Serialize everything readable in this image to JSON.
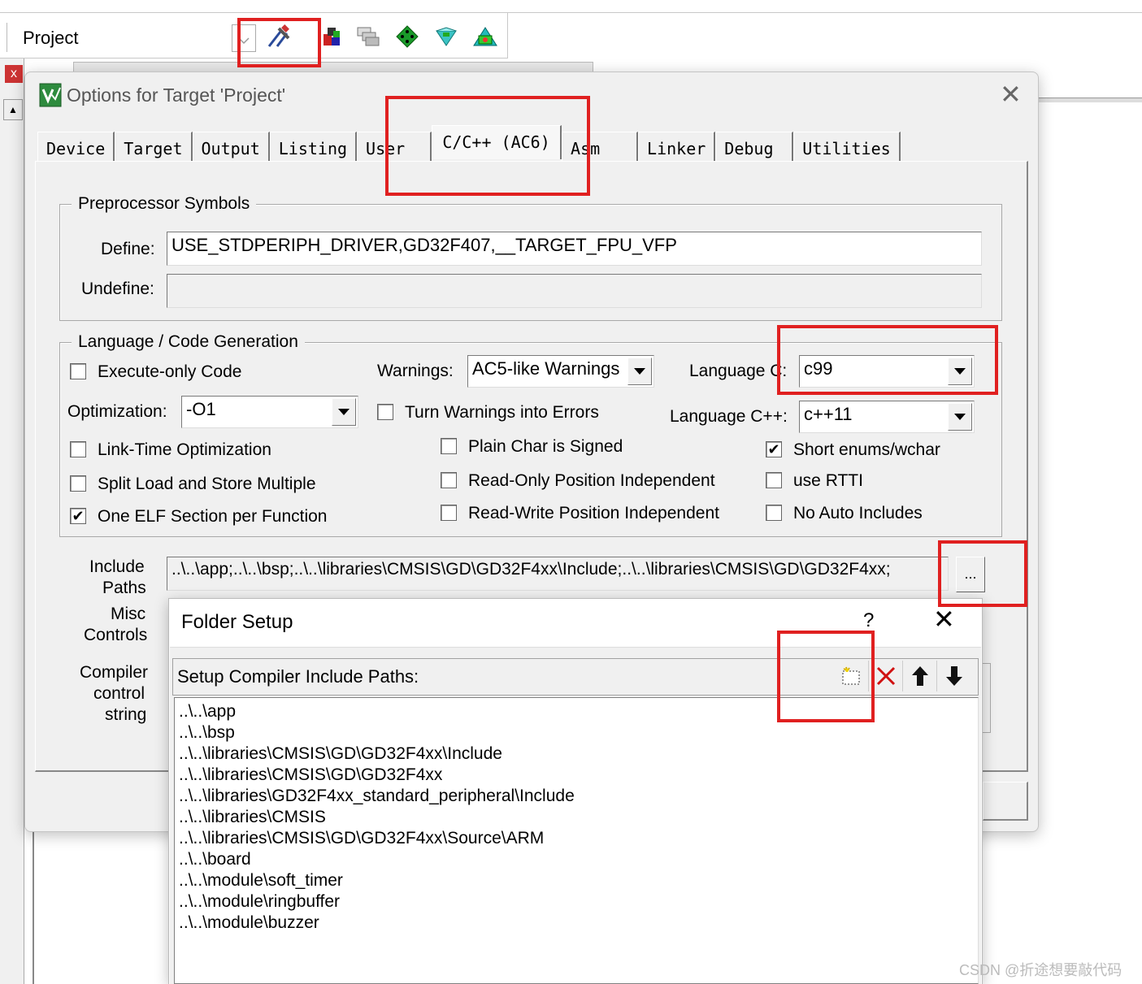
{
  "toolbar": {
    "project_label": "Project",
    "icons": [
      "options-for-target-icon",
      "manage-components-icon",
      "select-software-packs-icon",
      "pack-installer-icon",
      "runtime-environment-icon",
      "event-statistics-icon"
    ]
  },
  "ide": {
    "close_glyph": "x",
    "up_glyph": "▲"
  },
  "dialog": {
    "title": "Options for Target 'Project'",
    "close_glyph": "✕",
    "tabs": [
      "Device",
      "Target",
      "Output",
      "Listing",
      "User",
      "C/C++ (AC6)",
      "Asm",
      "Linker",
      "Debug",
      "Utilities"
    ],
    "active_tab": "C/C++ (AC6)",
    "preprocessor": {
      "title": "Preprocessor Symbols",
      "define_label": "Define:",
      "define_value": "USE_STDPERIPH_DRIVER,GD32F407,__TARGET_FPU_VFP",
      "undefine_label": "Undefine:",
      "undefine_value": ""
    },
    "language": {
      "title": "Language / Code Generation",
      "execute_only": {
        "label": "Execute-only Code",
        "checked": false
      },
      "warnings_label": "Warnings:",
      "warnings_value": "AC5-like Warnings",
      "language_c_label": "Language C:",
      "language_c_value": "c99",
      "optimization_label": "Optimization:",
      "optimization_value": "-O1",
      "turn_warnings": {
        "label": "Turn Warnings into Errors",
        "checked": false
      },
      "language_cpp_label": "Language C++:",
      "language_cpp_value": "c++11",
      "lto": {
        "label": "Link-Time Optimization",
        "checked": false
      },
      "plain_char": {
        "label": "Plain Char is Signed",
        "checked": false
      },
      "short_enums": {
        "label": "Short enums/wchar",
        "checked": true
      },
      "split_load": {
        "label": "Split Load and Store Multiple",
        "checked": false
      },
      "ropi": {
        "label": "Read-Only Position Independent",
        "checked": false
      },
      "rtti": {
        "label": "use RTTI",
        "checked": false
      },
      "one_elf": {
        "label": "One ELF Section per Function",
        "checked": true
      },
      "rwpi": {
        "label": "Read-Write Position Independent",
        "checked": false
      },
      "no_auto": {
        "label": "No Auto Includes",
        "checked": false
      },
      "check_glyph": "✔"
    },
    "include": {
      "label_line1": "Include",
      "label_line2": "Paths",
      "value": "..\\..\\app;..\\..\\bsp;..\\..\\libraries\\CMSIS\\GD\\GD32F4xx\\Include;..\\..\\libraries\\CMSIS\\GD\\GD32F4xx;",
      "browse_label": "..."
    },
    "misc_line1": "Misc",
    "misc_line2": "Controls",
    "compiler_line1": "Compiler",
    "compiler_line2": "control",
    "compiler_line3": "string"
  },
  "folder_setup": {
    "title": "Folder Setup",
    "help_glyph": "?",
    "close_glyph": "✕",
    "header_label": "Setup Compiler Include Paths:",
    "paths": [
      "..\\..\\app",
      "..\\..\\bsp",
      "..\\..\\libraries\\CMSIS\\GD\\GD32F4xx\\Include",
      "..\\..\\libraries\\CMSIS\\GD\\GD32F4xx",
      "..\\..\\libraries\\GD32F4xx_standard_peripheral\\Include",
      "..\\..\\libraries\\CMSIS",
      "..\\..\\libraries\\CMSIS\\GD\\GD32F4xx\\Source\\ARM",
      "..\\..\\board",
      "..\\..\\module\\soft_timer",
      "..\\..\\module\\ringbuffer",
      "..\\..\\module\\buzzer"
    ]
  },
  "watermark": "CSDN @折途想要敲代码",
  "colors": {
    "highlight": "#e02020",
    "dialog_bg": "#f0f0f0"
  }
}
